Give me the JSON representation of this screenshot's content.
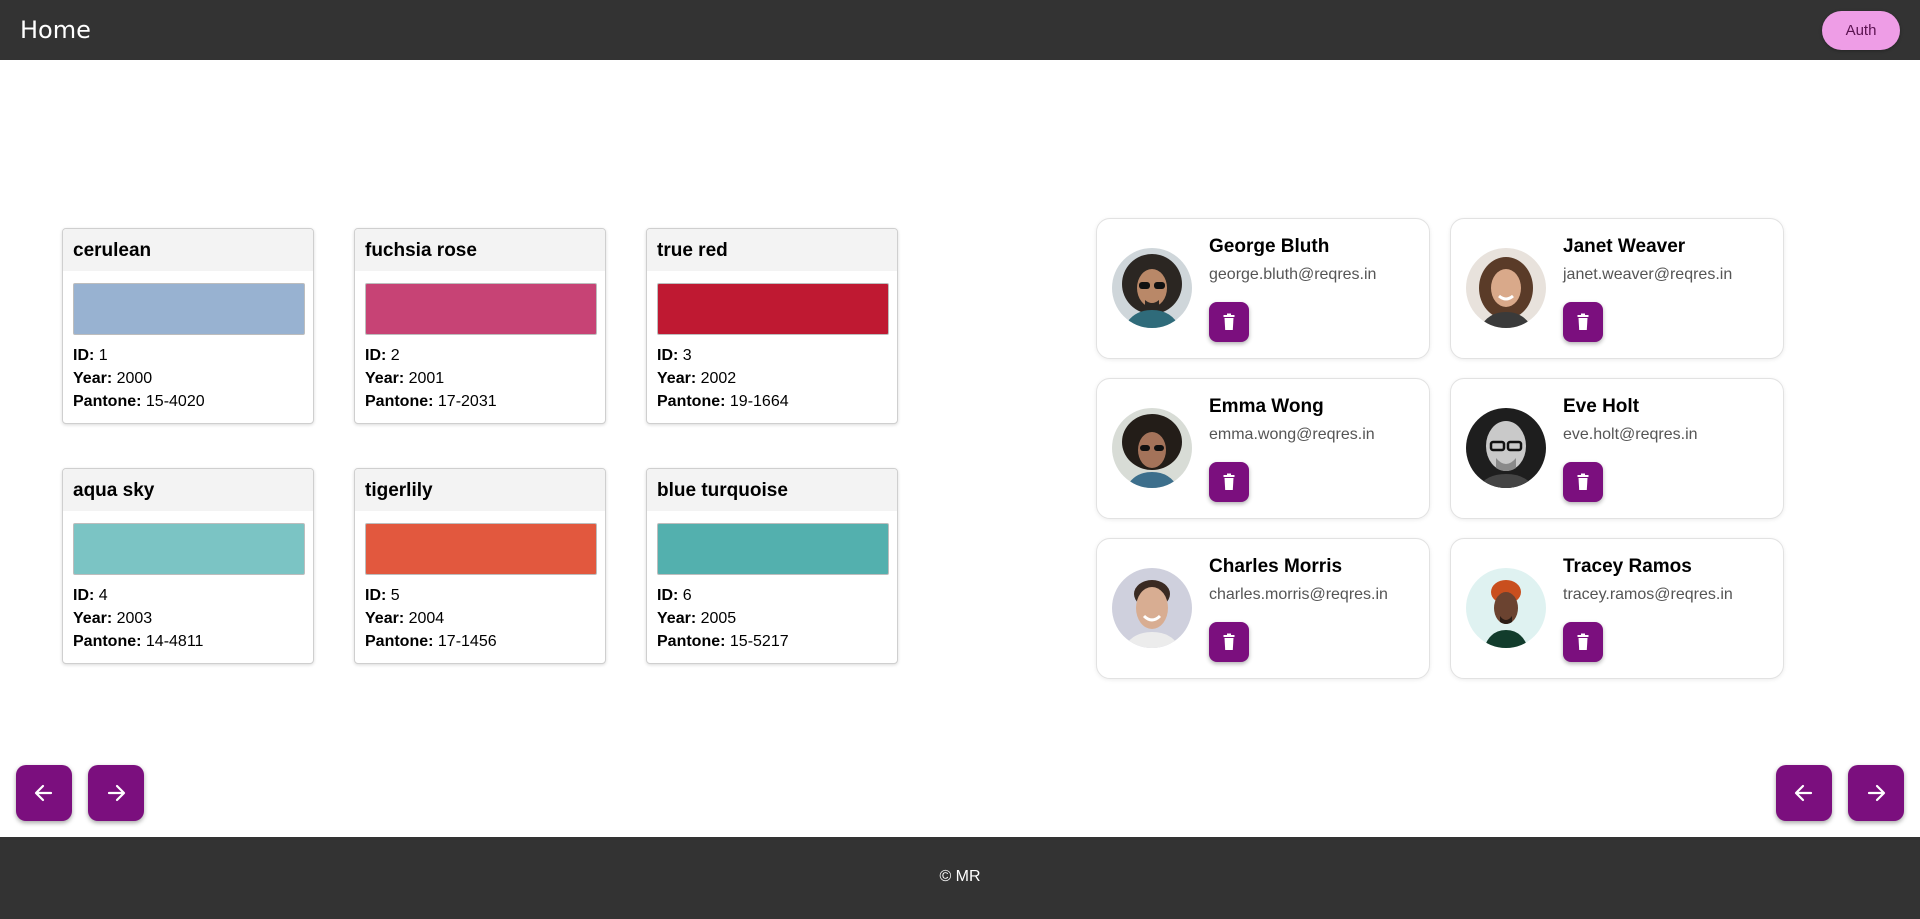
{
  "header": {
    "title": "Home",
    "auth_label": "Auth"
  },
  "colors": [
    {
      "name": "cerulean",
      "hex": "#98B2D1",
      "id": "1",
      "year": "2000",
      "pantone": "15-4020"
    },
    {
      "name": "fuchsia rose",
      "hex": "#C74375",
      "id": "2",
      "year": "2001",
      "pantone": "17-2031"
    },
    {
      "name": "true red",
      "hex": "#BF1932",
      "id": "3",
      "year": "2002",
      "pantone": "19-1664"
    },
    {
      "name": "aqua sky",
      "hex": "#7BC4C4",
      "id": "4",
      "year": "2003",
      "pantone": "14-4811"
    },
    {
      "name": "tigerlily",
      "hex": "#E2583E",
      "id": "5",
      "year": "2004",
      "pantone": "17-1456"
    },
    {
      "name": "blue turquoise",
      "hex": "#53B0AE",
      "id": "6",
      "year": "2005",
      "pantone": "15-5217"
    }
  ],
  "color_labels": {
    "id": "ID:",
    "year": "Year:",
    "pantone": "Pantone:"
  },
  "users": [
    {
      "name": "George Bluth",
      "email": "george.bluth@reqres.in"
    },
    {
      "name": "Janet Weaver",
      "email": "janet.weaver@reqres.in"
    },
    {
      "name": "Emma Wong",
      "email": "emma.wong@reqres.in"
    },
    {
      "name": "Eve Holt",
      "email": "eve.holt@reqres.in"
    },
    {
      "name": "Charles Morris",
      "email": "charles.morris@reqres.in"
    },
    {
      "name": "Tracey Ramos",
      "email": "tracey.ramos@reqres.in"
    }
  ],
  "footer": {
    "text": "© MR"
  },
  "theme": {
    "accent": "#7B0F7E",
    "auth_button": "#EE9DE6",
    "bar": "#333333"
  },
  "icons": {
    "prev": "arrow-left-icon",
    "next": "arrow-right-icon",
    "delete": "trash-icon"
  }
}
